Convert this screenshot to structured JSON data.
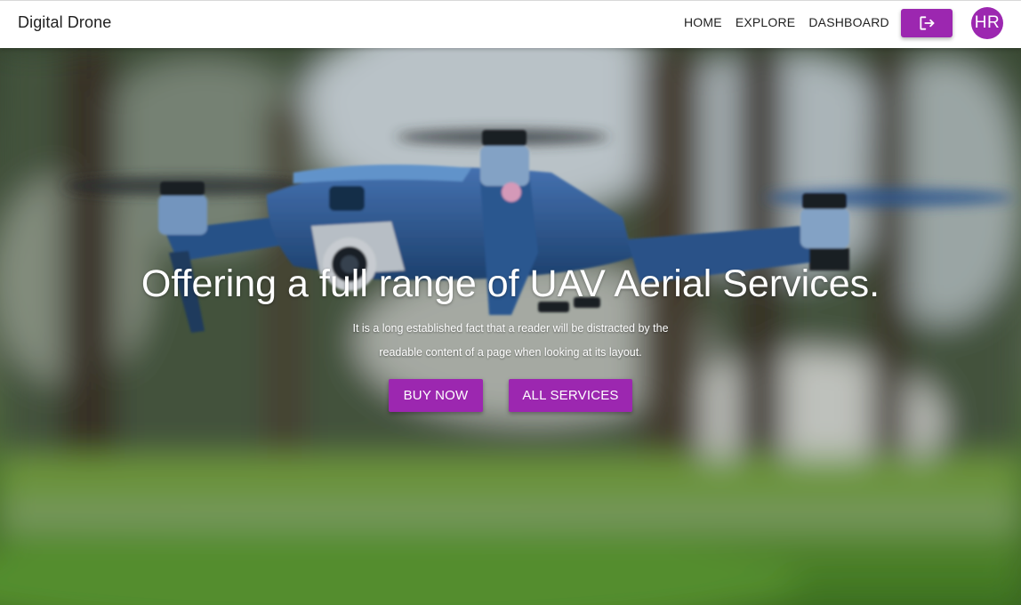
{
  "navbar": {
    "brand": "Digital Drone",
    "links": [
      {
        "label": "HOME"
      },
      {
        "label": "EXPLORE"
      },
      {
        "label": "DASHBOARD"
      }
    ],
    "logout_icon": "logout-icon",
    "avatar_initials": "HR"
  },
  "hero": {
    "title": "Offering a full range of UAV Aerial Services.",
    "subtitle": "It is a long established fact that a reader will be distracted by the readable content of a page when looking at its layout.",
    "buttons": [
      {
        "label": "BUY NOW"
      },
      {
        "label": "ALL SERVICES"
      }
    ]
  },
  "colors": {
    "accent": "#9c27b0",
    "navbar_bg": "#ffffff",
    "text_dark": "#1f1f1f"
  }
}
